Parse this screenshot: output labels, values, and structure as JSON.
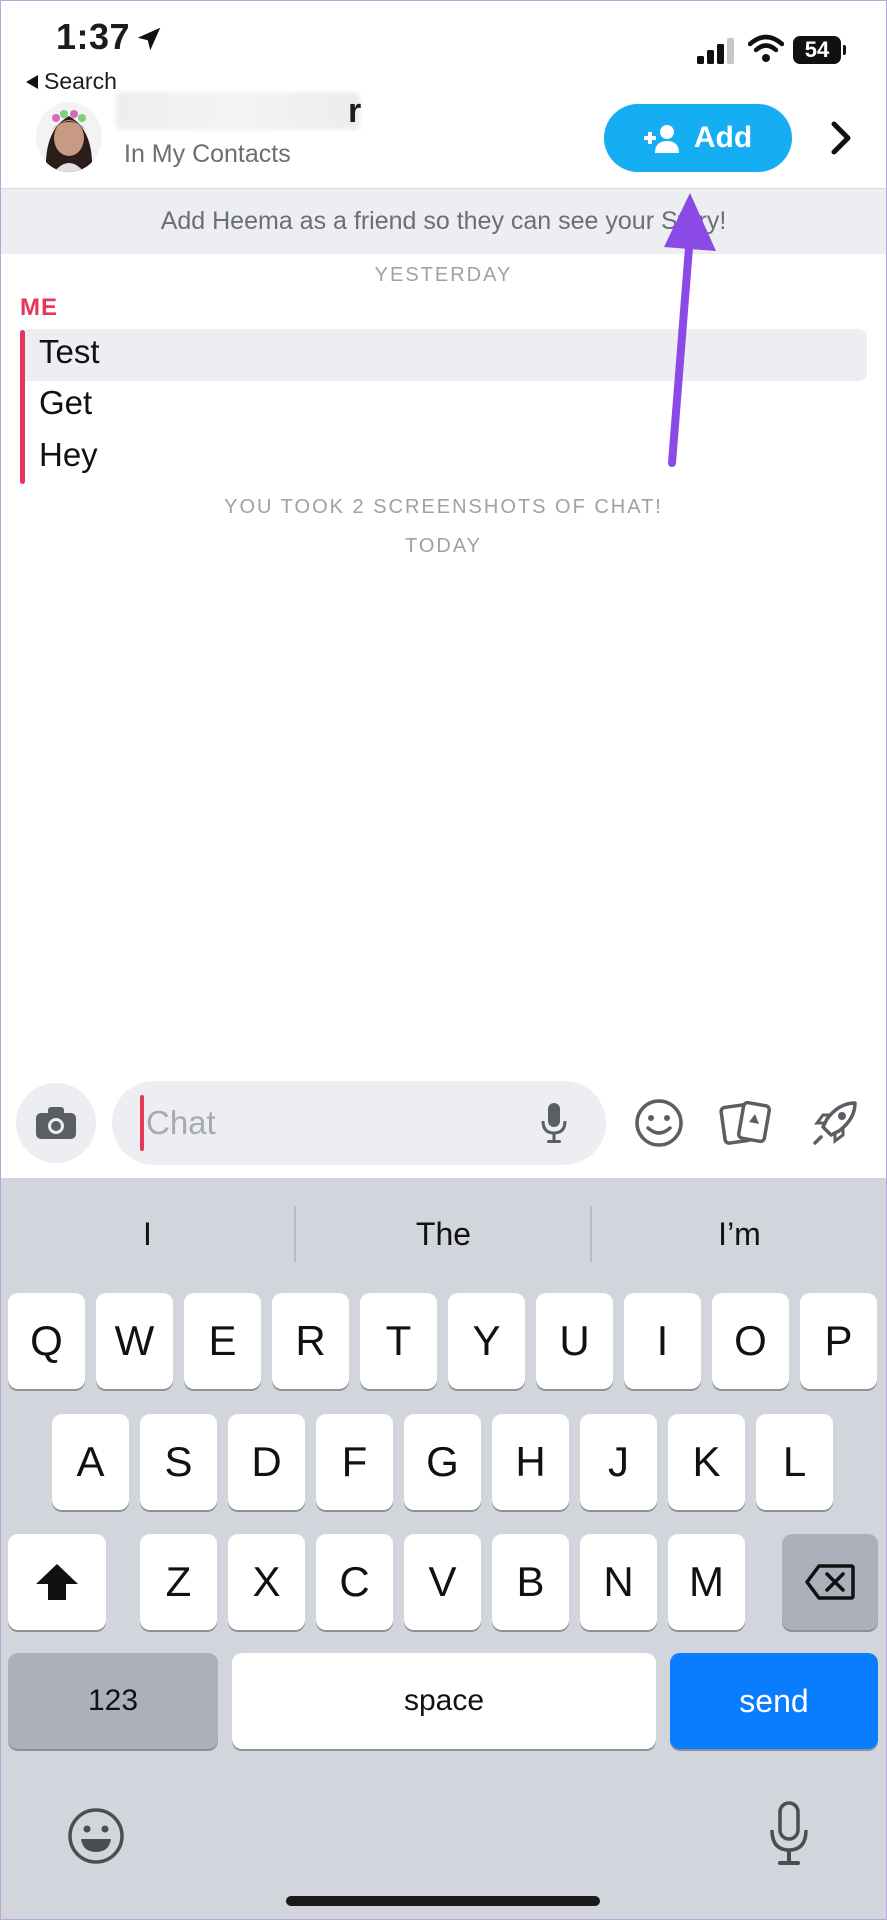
{
  "status_bar": {
    "time": "1:37",
    "battery": "54",
    "back_label": "Search"
  },
  "header": {
    "name_visible": "r",
    "subtitle": "In My Contacts",
    "add_label": "Add"
  },
  "banner": {
    "text": "Add Heema as a friend so they can see your Story!"
  },
  "chat": {
    "date_yesterday": "YESTERDAY",
    "sender": "ME",
    "messages": [
      "Test",
      "Get",
      "Hey"
    ],
    "screenshot_note": "YOU TOOK 2 SCREENSHOTS OF CHAT!",
    "date_today": "TODAY"
  },
  "input": {
    "placeholder": "Chat"
  },
  "keyboard": {
    "suggestions": [
      "I",
      "The",
      "I’m"
    ],
    "row1": [
      "Q",
      "W",
      "E",
      "R",
      "T",
      "Y",
      "U",
      "I",
      "O",
      "P"
    ],
    "row2": [
      "A",
      "S",
      "D",
      "F",
      "G",
      "H",
      "J",
      "K",
      "L"
    ],
    "row3": [
      "Z",
      "X",
      "C",
      "V",
      "B",
      "N",
      "M"
    ],
    "numbers_label": "123",
    "space_label": "space",
    "send_label": "send"
  },
  "colors": {
    "accent_blue": "#16aef3",
    "me_red": "#e4375a",
    "send_blue": "#0a7cff",
    "arrow_purple": "#8b4ae6"
  },
  "icons": [
    "location-arrow-icon",
    "signal-icon",
    "wifi-icon",
    "chevron-right-icon",
    "add-friend-icon",
    "camera-icon",
    "microphone-icon",
    "emoji-icon",
    "stickers-icon",
    "rocket-icon",
    "shift-icon",
    "backspace-icon",
    "emoji-keyboard-icon",
    "dictation-icon"
  ]
}
